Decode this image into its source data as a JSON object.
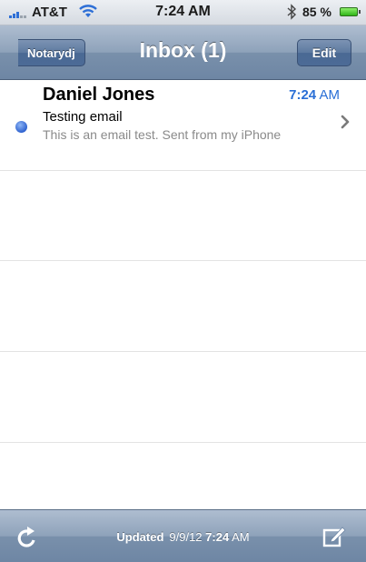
{
  "status_bar": {
    "carrier": "AT&T",
    "time": "7:24 AM",
    "battery_percent": "85 %",
    "icons": [
      "signal-icon",
      "wifi-icon",
      "bluetooth-icon",
      "battery-icon"
    ]
  },
  "nav": {
    "back_label": "Notarydj",
    "title": "Inbox (1)",
    "edit_label": "Edit"
  },
  "messages": [
    {
      "sender": "Daniel Jones",
      "time_main": "7:24",
      "time_suffix": "AM",
      "subject": "Testing email",
      "preview": "This is an email test. Sent from my iPhone",
      "unread": true
    }
  ],
  "toolbar": {
    "updated_label": "Updated",
    "updated_date": "9/9/12",
    "updated_time": "7:24",
    "updated_ampm": "AM",
    "icons": [
      "refresh-icon",
      "compose-icon"
    ]
  },
  "colors": {
    "accent": "#2a6fd6",
    "nav_bar": "#8ea2ba",
    "unread_dot": "#2f63d0"
  }
}
